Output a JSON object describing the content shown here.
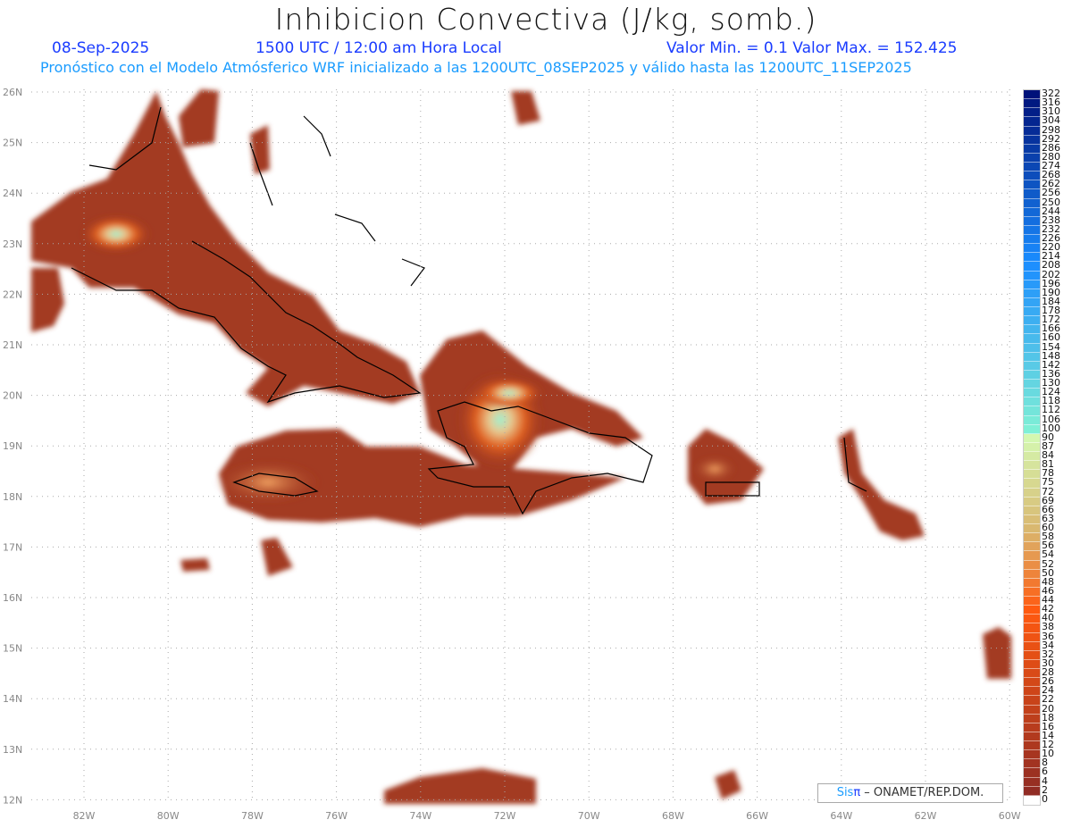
{
  "header": {
    "title": "Inhibicion Convectiva (J/kg, somb.)",
    "date": "08-Sep-2025",
    "time": "1500 UTC / 12:00 am Hora Local",
    "minmax": "Valor Min. = 0.1  Valor Max. = 152.425",
    "subtitle": "Pronóstico con el Modelo Atmósferico WRF inicializado a las 1200UTC_08SEP2025 y válido hasta las  1200UTC_11SEP2025"
  },
  "axes": {
    "lon_labels": [
      "82W",
      "80W",
      "78W",
      "76W",
      "74W",
      "72W",
      "70W",
      "68W",
      "66W",
      "64W",
      "62W",
      "60W"
    ],
    "lat_labels": [
      "26N",
      "25N",
      "24N",
      "23N",
      "22N",
      "21N",
      "20N",
      "19N",
      "18N",
      "17N",
      "16N",
      "15N",
      "14N",
      "13N",
      "12N"
    ]
  },
  "colorbar": {
    "levels": [
      322,
      316,
      310,
      304,
      298,
      292,
      286,
      280,
      274,
      268,
      262,
      256,
      250,
      244,
      238,
      232,
      226,
      220,
      214,
      208,
      202,
      196,
      190,
      184,
      178,
      172,
      166,
      160,
      154,
      148,
      142,
      136,
      130,
      124,
      118,
      112,
      106,
      100,
      90,
      87,
      84,
      81,
      78,
      75,
      72,
      69,
      66,
      63,
      60,
      58,
      56,
      54,
      52,
      50,
      48,
      46,
      44,
      42,
      40,
      38,
      36,
      34,
      32,
      30,
      28,
      26,
      24,
      22,
      20,
      18,
      16,
      14,
      12,
      10,
      8,
      6,
      4,
      2,
      0
    ],
    "colors": {
      "high": "#00127a",
      "mid": "#1a8cff",
      "cyan": "#7ff0d6",
      "lightgreen": "#d4f7b0",
      "tan": "#d9b870",
      "orange": "#ff5a10",
      "brown": "#8c2a25",
      "zero": "#ffffff"
    }
  },
  "credit": {
    "brand_a": "Sis",
    "brand_b": "π",
    "text": " –  ONAMET/REP.DOM."
  }
}
